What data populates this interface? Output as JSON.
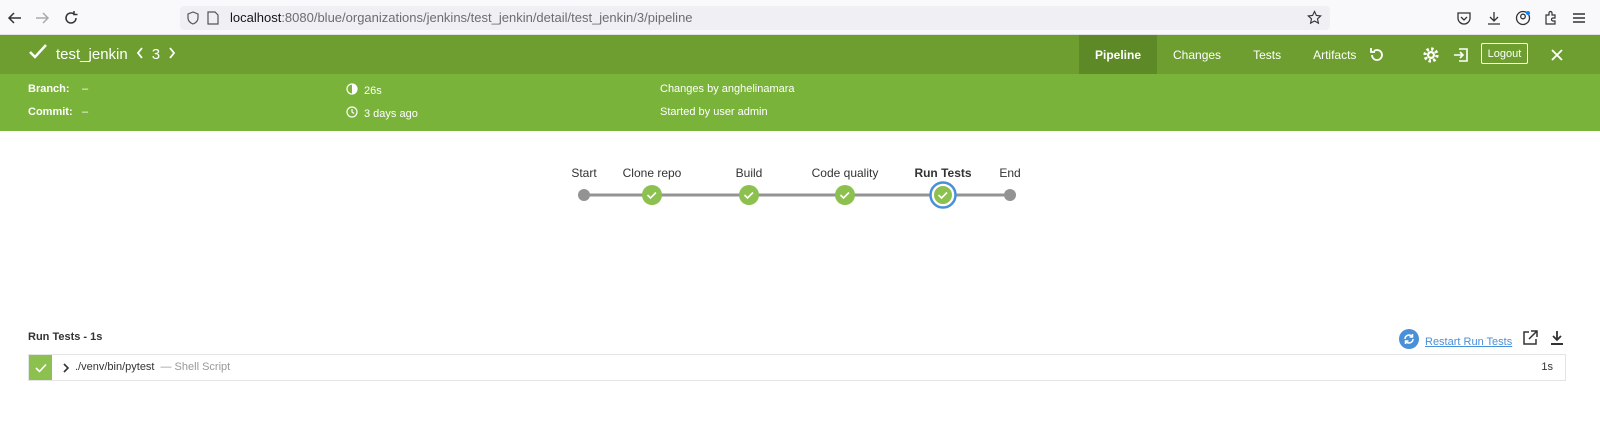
{
  "browser": {
    "url_host": "localhost",
    "url_rest": ":8080/blue/organizations/jenkins/test_jenkin/detail/test_jenkin/3/pipeline"
  },
  "header": {
    "title": "test_jenkin",
    "run_number": "3",
    "tabs": [
      {
        "label": "Pipeline",
        "active": true
      },
      {
        "label": "Changes",
        "active": false
      },
      {
        "label": "Tests",
        "active": false
      },
      {
        "label": "Artifacts",
        "active": false
      }
    ],
    "logout_label": "Logout"
  },
  "meta": {
    "branch_label": "Branch:",
    "branch_value": "–",
    "commit_label": "Commit:",
    "commit_value": "–",
    "duration": "26s",
    "time_ago": "3 days ago",
    "changes": "Changes by anghelinamara",
    "started_by": "Started by user admin"
  },
  "pipeline": {
    "stages": [
      {
        "name": "Start",
        "status": "start"
      },
      {
        "name": "Clone repo",
        "status": "success"
      },
      {
        "name": "Build",
        "status": "success"
      },
      {
        "name": "Code quality",
        "status": "success"
      },
      {
        "name": "Run Tests",
        "status": "success",
        "selected": true
      },
      {
        "name": "End",
        "status": "end"
      }
    ]
  },
  "step_panel": {
    "title": "Run Tests - 1s",
    "restart_label": "Restart Run Tests",
    "steps": [
      {
        "command": "./venv/bin/pytest",
        "type": "— Shell Script",
        "duration": "1s"
      }
    ]
  },
  "colors": {
    "header": "#6d9e2f",
    "meta": "#7ab33a",
    "success": "#8cc04f",
    "selected_ring": "#4a90d9",
    "node_grey": "#949393"
  }
}
